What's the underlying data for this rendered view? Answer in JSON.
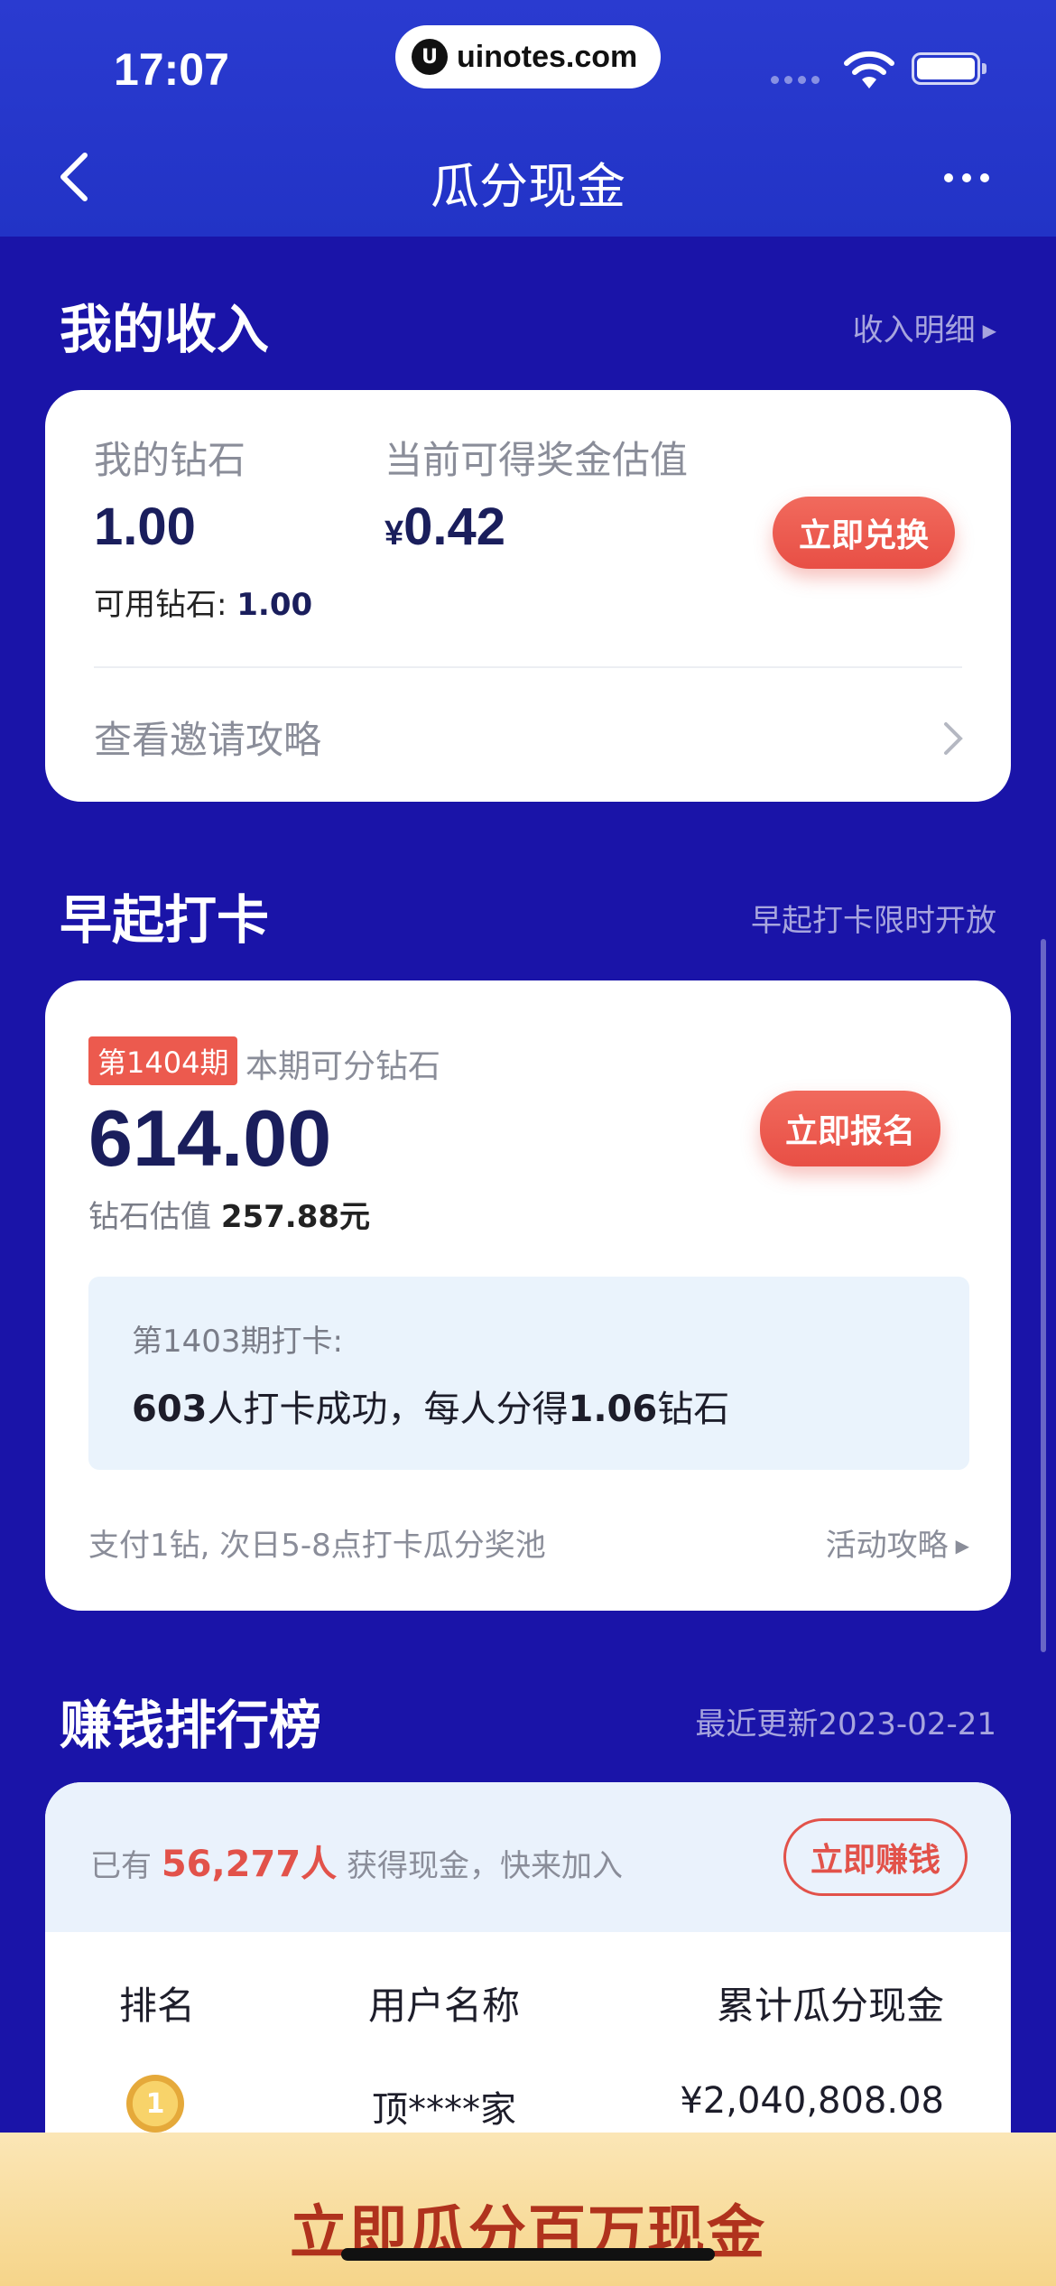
{
  "status": {
    "time": "17:07",
    "url": "uinotes.com"
  },
  "nav": {
    "title": "瓜分现金"
  },
  "income": {
    "section_title": "我的收入",
    "detail_link": "收入明细",
    "diamonds_label": "我的钻石",
    "diamonds_value": "1.00",
    "available_label": "可用钻石: ",
    "available_value": "1.00",
    "bonus_label": "当前可得奖金估值",
    "currency_symbol": "¥",
    "bonus_value": "0.42",
    "exchange_button": "立即兑换",
    "invite_link": "查看邀请攻略"
  },
  "checkin": {
    "section_title": "早起打卡",
    "section_note": "早起打卡限时开放",
    "period_badge": "第1404期",
    "period_label": "本期可分钻石",
    "period_diamonds": "614.00",
    "estimate_label": "钻石估值 ",
    "estimate_value": "257.88元",
    "signup_button": "立即报名",
    "last_period_title": "第1403期打卡:",
    "last_count": "603",
    "last_text_1": "人打卡成功，每人分得",
    "last_share": "1.06",
    "last_text_2": "钻石",
    "rule_text": "支付1钻, 次日5-8点打卡瓜分奖池",
    "guide_link": "活动攻略"
  },
  "ranking": {
    "section_title": "赚钱排行榜",
    "updated": "最近更新2023-02-21",
    "banner_prefix": "已有 ",
    "banner_count": "56,277人",
    "banner_suffix": " 获得现金，快来加入",
    "earn_button": "立即赚钱",
    "columns": [
      "排名",
      "用户名称",
      "累计瓜分现金"
    ],
    "rows": [
      {
        "rank": "1",
        "name": "顶****家",
        "amount": "¥2,040,808.08"
      }
    ]
  },
  "bottom_cta": "立即瓜分百万现金",
  "colors": {
    "background": "#1a14a8",
    "accent_red": "#e84f45",
    "navy_text": "#1a1e5c"
  }
}
